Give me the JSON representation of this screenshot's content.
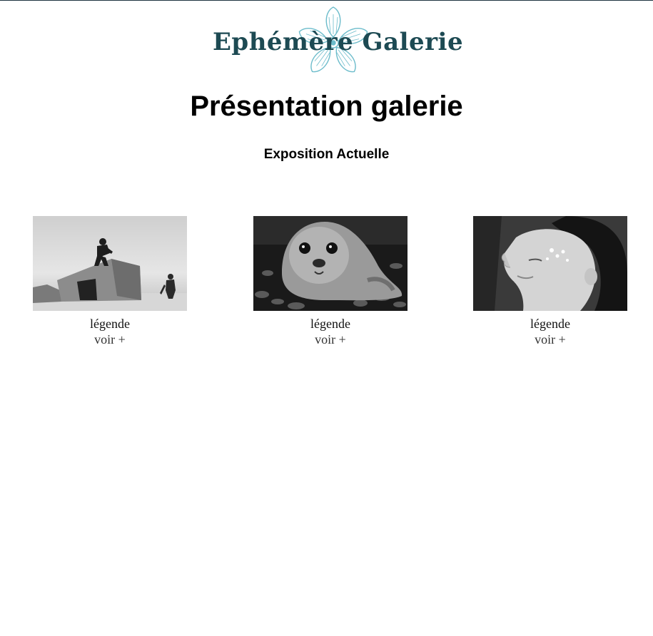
{
  "header": {
    "logo_text": "Ephémère Galerie",
    "logo_icon": "flower-icon",
    "brand_color": "#1d4a53",
    "flower_color": "#6cbccb"
  },
  "main": {
    "title": "Présentation galerie",
    "subtitle": "Exposition Actuelle",
    "gallery": [
      {
        "photo": "children-on-bunker-photo",
        "caption": "légende",
        "more_link": "voir +"
      },
      {
        "photo": "seal-on-pebbles-photo",
        "caption": "légende",
        "more_link": "voir +"
      },
      {
        "photo": "woman-with-flowers-on-face-photo",
        "caption": "légende",
        "more_link": "voir +"
      }
    ]
  }
}
